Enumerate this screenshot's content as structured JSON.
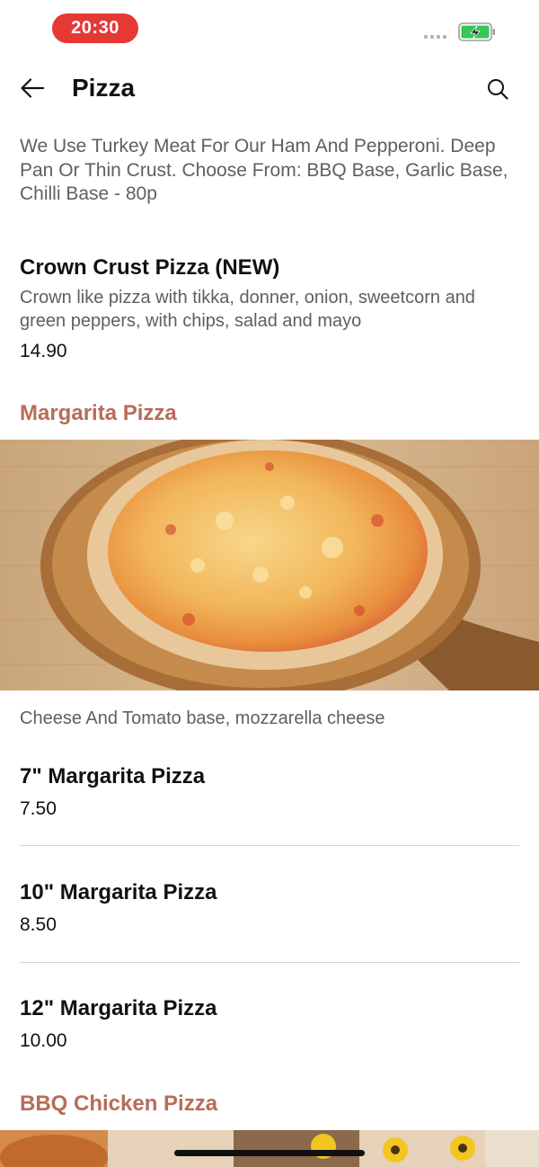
{
  "status_bar": {
    "time": "20:30"
  },
  "header": {
    "title": "Pizza"
  },
  "intro_text": "We Use Turkey Meat For Our Ham And Pepperoni. Deep Pan Or Thin Crust. Choose From: BBQ Base, Garlic Base, Chilli Base - 80p",
  "crown_item": {
    "name": "Crown Crust Pizza (NEW)",
    "description": "Crown like pizza with tikka, donner, onion, sweetcorn and green peppers, with chips, salad and mayo",
    "price": "14.90"
  },
  "margarita_section": {
    "title": "Margarita Pizza",
    "description": "Cheese And Tomato base, mozzarella cheese",
    "items": [
      {
        "name": "7\" Margarita Pizza",
        "price": "7.50"
      },
      {
        "name": "10\" Margarita Pizza",
        "price": "8.50"
      },
      {
        "name": "12\" Margarita Pizza",
        "price": "10.00"
      }
    ]
  },
  "bbq_section": {
    "title": "BBQ Chicken Pizza"
  },
  "icons": {
    "back": "arrow-left-icon",
    "search": "search-icon",
    "battery": "battery-charging-icon"
  },
  "colors": {
    "time_pill": "#e53935",
    "section_title": "#b86c57",
    "battery": "#34c759"
  }
}
